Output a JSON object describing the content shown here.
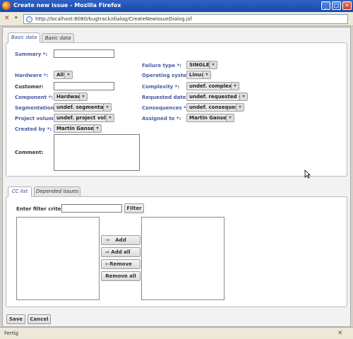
{
  "window": {
    "title": "Create new issue - Mozilla Firefox",
    "url": "http://localhost:8080/bugtrack/dialog/CreateNewIssueDialog.jsf",
    "minimize_label": "_",
    "maximize_label": "□",
    "close_label": "×"
  },
  "basic_tabs": [
    "Basic data",
    "Basic data"
  ],
  "form": {
    "summary_label": "Summary *:",
    "summary_value": "",
    "failure_type_label": "Failure type *:",
    "failure_type_value": "SINGLE",
    "hardware_label": "Hardware *:",
    "hardware_value": "All",
    "operating_system_label": "Operating system *:",
    "operating_system_value": "Linux",
    "customer_label": "Customer:",
    "customer_value": "",
    "complexity_label": "Complexity *:",
    "complexity_value": "undef. complexity",
    "component_label": "Component *:",
    "component_value": "Hardware",
    "requested_date_label": "Requested date *:",
    "requested_date_value": "undef. requested date",
    "segmentation_label": "Segmentation *:",
    "segmentation_value": "undef. segmentation",
    "consequences_label": "Consequences *:",
    "consequences_value": "undef. consequence",
    "project_volume_label": "Project volume *:",
    "project_volume_value": "undef. project volume",
    "assigned_to_label": "Assigned to *:",
    "assigned_to_value": "Martin Ganserer",
    "created_by_label": "Created by *:",
    "created_by_value": "Martin Ganserer",
    "comment_label": "Comment:",
    "comment_value": ""
  },
  "cc_tabs": [
    "CC list",
    "Depended issues"
  ],
  "cc": {
    "filter_label": "Enter filter criterion:",
    "filter_value": "",
    "filter_button": "Filter",
    "add_button": "Add",
    "add_all_button": "Add all",
    "remove_button": "Remove",
    "remove_all_button": "Remove all"
  },
  "footer": {
    "save_button": "Save",
    "cancel_button": "Cancel"
  },
  "status": {
    "text": "Fertig"
  }
}
